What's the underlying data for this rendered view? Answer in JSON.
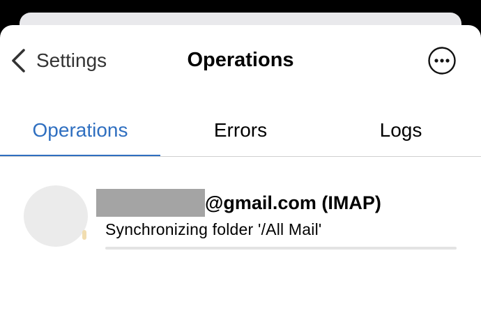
{
  "nav": {
    "back_label": "Settings",
    "title": "Operations",
    "back_icon": "chevron-left-icon",
    "more_icon": "ellipsis-circle-icon"
  },
  "tabs": [
    {
      "label": "Operations",
      "active": true
    },
    {
      "label": "Errors",
      "active": false
    },
    {
      "label": "Logs",
      "active": false
    }
  ],
  "operation": {
    "account_suffix": "@gmail.com (IMAP)",
    "status": "Synchronizing folder '/All Mail'",
    "progress": 0
  },
  "colors": {
    "accent": "#2f6fc0",
    "redaction": "#a4a4a4"
  }
}
